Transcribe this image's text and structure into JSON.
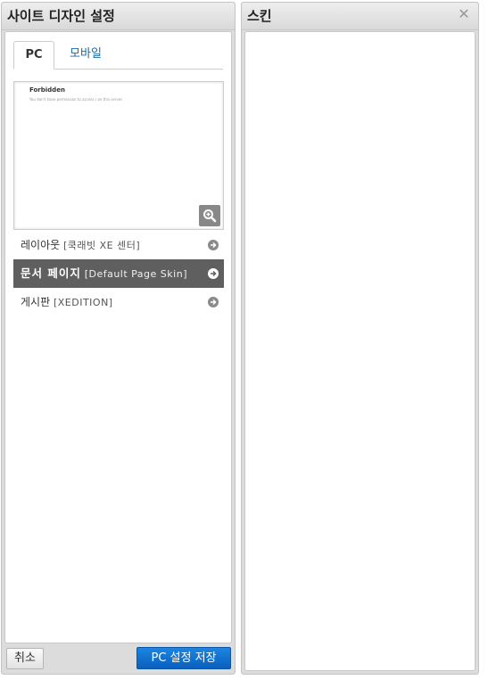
{
  "left_panel": {
    "title": "사이트 디자인 설정",
    "tabs": [
      {
        "label": "PC"
      },
      {
        "label": "모바일"
      }
    ],
    "preview": {
      "title": "Forbidden",
      "text": "You don't have permission to access / on this server."
    },
    "skins": [
      {
        "name": "레이아웃",
        "skin": "[쿡래빗 XE 센터]"
      },
      {
        "name": "문서 페이지",
        "skin": "Default Page Skin"
      },
      {
        "name": "게시판",
        "skin": "[XEDITION]"
      }
    ],
    "cancel_label": "취소",
    "save_label": "PC 설정 저장"
  },
  "right_panel": {
    "title": "스킨"
  },
  "colors": {
    "selected_bg": "#5f5f5f",
    "primary_button": "#0a6ad0",
    "tab_link": "#1a6aa5"
  }
}
